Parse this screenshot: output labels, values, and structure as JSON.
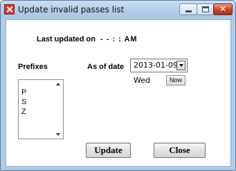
{
  "window": {
    "title": "Update invalid passes list",
    "title_icon": "app-logo-icon",
    "controls": [
      "minimize-icon",
      "maximize-icon",
      "close-icon"
    ]
  },
  "status": {
    "last_updated_label": "Last updated on",
    "last_updated_value": "- -  : :  AM"
  },
  "prefixes": {
    "label": "Prefixes",
    "items": [
      "P",
      "S",
      "Z"
    ]
  },
  "date": {
    "label": "As of date",
    "value": "2013-01-09",
    "day": "Wed",
    "now_label": "Now"
  },
  "buttons": {
    "update": "Update",
    "close": "Close"
  }
}
